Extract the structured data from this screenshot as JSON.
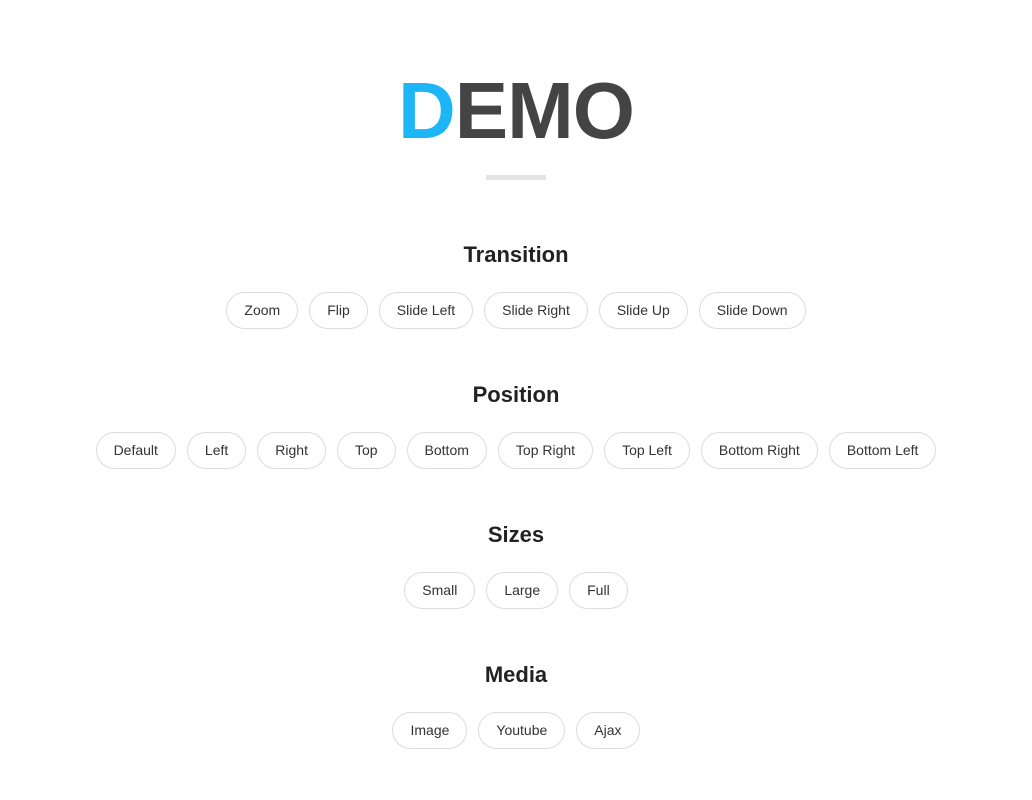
{
  "hero": {
    "title_accent": "D",
    "title_rest": "EMO"
  },
  "sections": [
    {
      "title": "Transition",
      "buttons": [
        "Zoom",
        "Flip",
        "Slide Left",
        "Slide Right",
        "Slide Up",
        "Slide Down"
      ]
    },
    {
      "title": "Position",
      "buttons": [
        "Default",
        "Left",
        "Right",
        "Top",
        "Bottom",
        "Top Right",
        "Top Left",
        "Bottom Right",
        "Bottom Left"
      ]
    },
    {
      "title": "Sizes",
      "buttons": [
        "Small",
        "Large",
        "Full"
      ]
    },
    {
      "title": "Media",
      "buttons": [
        "Image",
        "Youtube",
        "Ajax"
      ]
    }
  ],
  "colors": {
    "accent": "#1cb6f6",
    "title": "#444444"
  }
}
